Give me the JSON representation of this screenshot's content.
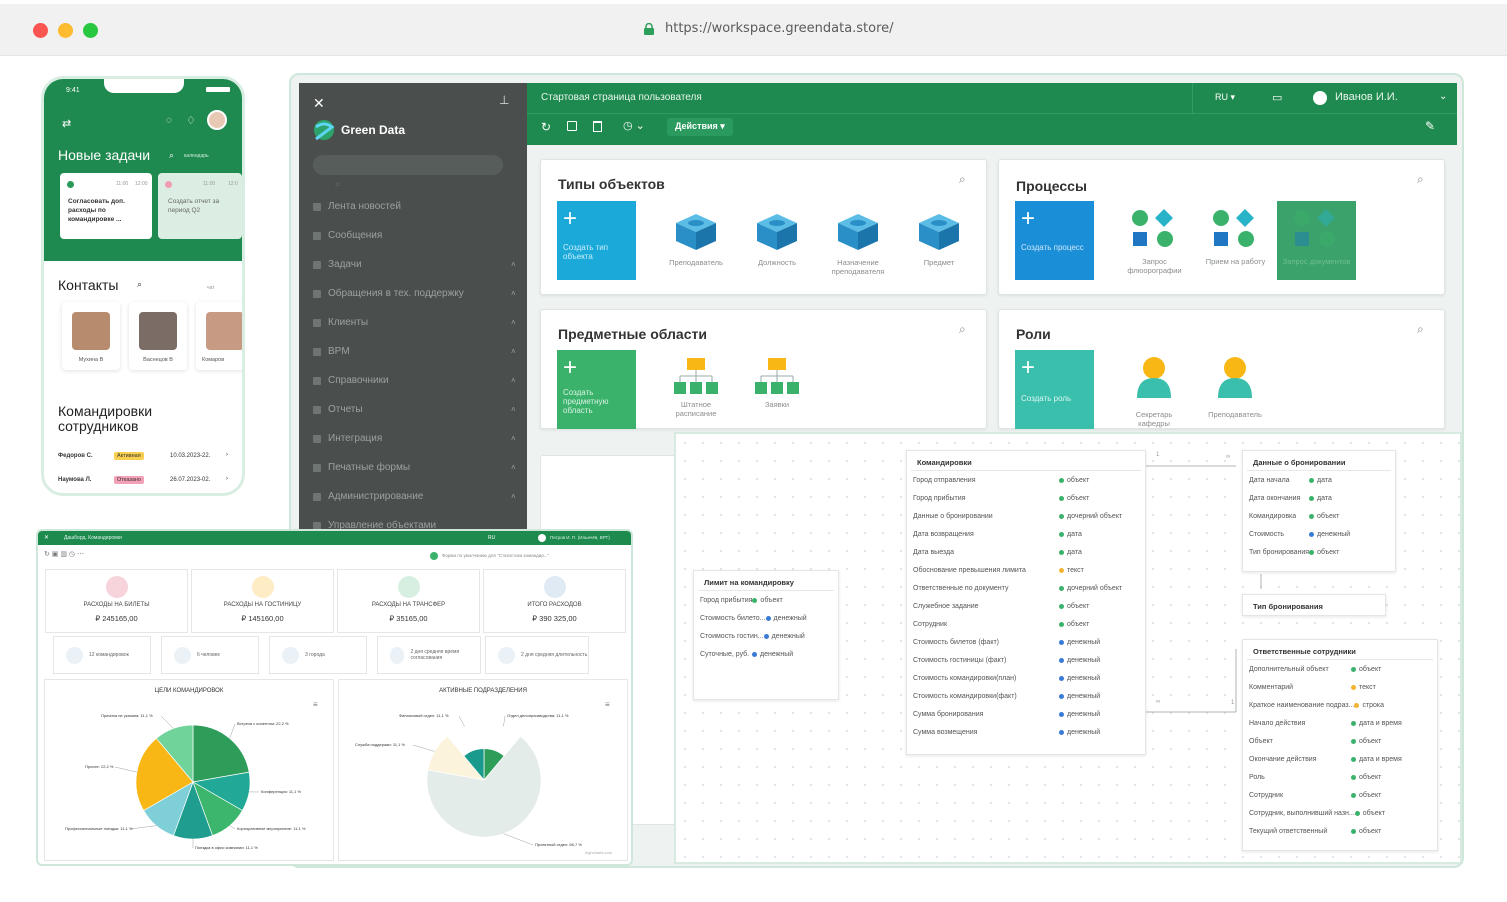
{
  "browser": {
    "url": "https://workspace.greendata.store/"
  },
  "colors": {
    "brand": "#1f8a4f",
    "sidebar": "#4a4f4e",
    "blue": "#1a8fd8",
    "teal": "#3bbfad",
    "cyan": "#1aa9d9"
  },
  "phone": {
    "time": "9:41",
    "tasks_title": "Новые задачи",
    "tasks_link": "календарь",
    "task1": {
      "from": "11:00",
      "to": "12:00",
      "text": "Согласовать доп. расходы по командировке ..."
    },
    "task2": {
      "from": "11:00",
      "to": "12:0",
      "text": "Создать отчет за период Q2"
    },
    "contacts_title": "Контакты",
    "contacts_link": "чат",
    "contacts": [
      "Мухина В",
      "Васнецов В",
      "Комаров"
    ],
    "trips_title_1": "Командировки",
    "trips_title_2": "сотрудников",
    "trips": [
      {
        "name": "Федоров С.",
        "status": "Активная",
        "date": "10.03.2023-22."
      },
      {
        "name": "Наумова Л.",
        "status": "Отказано",
        "date": "26.07.2023-02."
      }
    ]
  },
  "app": {
    "brand": "Green Data",
    "page_title": "Стартовая страница пользователя",
    "lang": "RU",
    "user": "Иванов И.И.",
    "actions": "Действия",
    "menu": [
      "Лента новостей",
      "Сообщения",
      "Задачи",
      "Обращения в тех. поддержку",
      "Клиенты",
      "BPM",
      "Справочники",
      "Отчеты",
      "Интеграция",
      "Печатные формы",
      "Администрирование",
      "Управление объектами"
    ],
    "object_types": {
      "title": "Типы объектов",
      "create": "Создать тип объекта",
      "items": [
        "Преподаватель",
        "Должность",
        "Назначение преподавателя",
        "Предмет"
      ]
    },
    "processes": {
      "title": "Процессы",
      "create": "Создать процесс",
      "items": [
        "Запрос флюорографии",
        "Прием на работу",
        "Запрос документов"
      ]
    },
    "domains": {
      "title": "Предметные области",
      "create": "Создать предметную область",
      "items": [
        "Штатное расписание",
        "Заявки"
      ]
    },
    "roles": {
      "title": "Роли",
      "create": "Создать роль",
      "items": [
        "Секретарь кафедры",
        "Преподаватель"
      ]
    }
  },
  "er": {
    "limit": {
      "title": "Лимит на командировку",
      "rows": [
        [
          "Город прибытия",
          "объект",
          "g"
        ],
        [
          "Стоимость билето...",
          "денежный",
          "b"
        ],
        [
          "Стоимость гостин...",
          "денежный",
          "b"
        ],
        [
          "Суточные, руб.",
          "денежный",
          "b"
        ]
      ]
    },
    "trips": {
      "title": "Командировки",
      "rows": [
        [
          "Город отправления",
          "объект",
          "g"
        ],
        [
          "Город прибытия",
          "объект",
          "g"
        ],
        [
          "Данные о бронировании",
          "дочерний объект",
          "g"
        ],
        [
          "Дата возвращения",
          "дата",
          "g"
        ],
        [
          "Дата выезда",
          "дата",
          "g"
        ],
        [
          "Обоснование превышения лимита",
          "текст",
          "o"
        ],
        [
          "Ответственные по документу",
          "дочерний объект",
          "g"
        ],
        [
          "Служебное задание",
          "объект",
          "g"
        ],
        [
          "Сотрудник",
          "объект",
          "g"
        ],
        [
          "Стоимость билетов (факт)",
          "денежный",
          "b"
        ],
        [
          "Стоимость гостиницы (факт)",
          "денежный",
          "b"
        ],
        [
          "Стоимость командировки(план)",
          "денежный",
          "b"
        ],
        [
          "Стоимость командировки(факт)",
          "денежный",
          "b"
        ],
        [
          "Сумма бронирования",
          "денежный",
          "b"
        ],
        [
          "Сумма возмещения",
          "денежный",
          "b"
        ]
      ]
    },
    "booking": {
      "title": "Данные о бронировании",
      "rows": [
        [
          "Дата начала",
          "дата",
          "g"
        ],
        [
          "Дата окончания",
          "дата",
          "g"
        ],
        [
          "Командировка",
          "объект",
          "g"
        ],
        [
          "Стоимость",
          "денежный",
          "b"
        ],
        [
          "Тип бронирования",
          "объект",
          "g"
        ]
      ]
    },
    "booking_type": {
      "title": "Тип бронирования"
    },
    "responsible": {
      "title": "Ответственные сотрудники",
      "rows": [
        [
          "Дополнительный объект",
          "объект",
          "g"
        ],
        [
          "Комментарий",
          "текст",
          "o"
        ],
        [
          "Краткое наименование подраз...",
          "строка",
          "o"
        ],
        [
          "Начало действия",
          "дата и время",
          "g"
        ],
        [
          "Объект",
          "объект",
          "g"
        ],
        [
          "Окончание действия",
          "дата и время",
          "g"
        ],
        [
          "Роль",
          "объект",
          "g"
        ],
        [
          "Сотрудник",
          "объект",
          "g"
        ],
        [
          "Сотрудник, выполнивший назн...",
          "объект",
          "g"
        ],
        [
          "Текущий ответственный",
          "объект",
          "g"
        ]
      ]
    },
    "link_labels": [
      "1",
      "∞",
      "∞",
      "1"
    ]
  },
  "dashboard": {
    "title": "Дашборд. Командировки",
    "lang": "RU",
    "user": "Петров И. П. (Ильичёв, ВРТ)",
    "form_note": "Форма по умолчанию для \"Статистика командир...\"",
    "kpis": [
      {
        "name": "Расходы на билеты",
        "value": "₽ 245165,00",
        "color": "#f7d3dc"
      },
      {
        "name": "Расходы на гостиницу",
        "value": "₽ 145160,00",
        "color": "#fdecc4"
      },
      {
        "name": "Расходы на трансфер",
        "value": "₽ 35165,00",
        "color": "#d7efe0"
      },
      {
        "name": "Итого расходов",
        "value": "₽ 390 325,00",
        "color": "#dfeaf5"
      }
    ],
    "minis": [
      "12 командировок",
      "6 человек",
      "3 города",
      "2 дня средняя время согласования",
      "2 дня средняя длительность"
    ],
    "chart1_title": "Цели командировок",
    "chart2_title": "Активные подразделения",
    "credit": "highcharts.com"
  },
  "chart_data": [
    {
      "type": "pie",
      "title": "Цели командировок",
      "labels": [
        "Встреча с клиентом",
        "Конференция",
        "Корпоративное мероприятие",
        "Поездка в офис компании",
        "Профессиональные поездки",
        "Прочее",
        "Причина не указана"
      ],
      "values": [
        22.2,
        11.1,
        11.1,
        11.1,
        11.1,
        22.2,
        11.1
      ],
      "colors": [
        "#2e9d5a",
        "#22a896",
        "#3cb66c",
        "#1f9e8f",
        "#7fcfd8",
        "#f8b715",
        "#6fd39a"
      ]
    },
    {
      "type": "pie",
      "title": "Активные подразделения",
      "labels": [
        "Отдел делопроизводства",
        "Проектный отдел",
        "Служба поддержки",
        "Финансовый отдел"
      ],
      "values": [
        11.1,
        66.7,
        11.1,
        11.1
      ],
      "colors": [
        "#2e9d5a",
        "#e3ece8",
        "#fbf3dc",
        "#1a9a8c"
      ]
    }
  ]
}
